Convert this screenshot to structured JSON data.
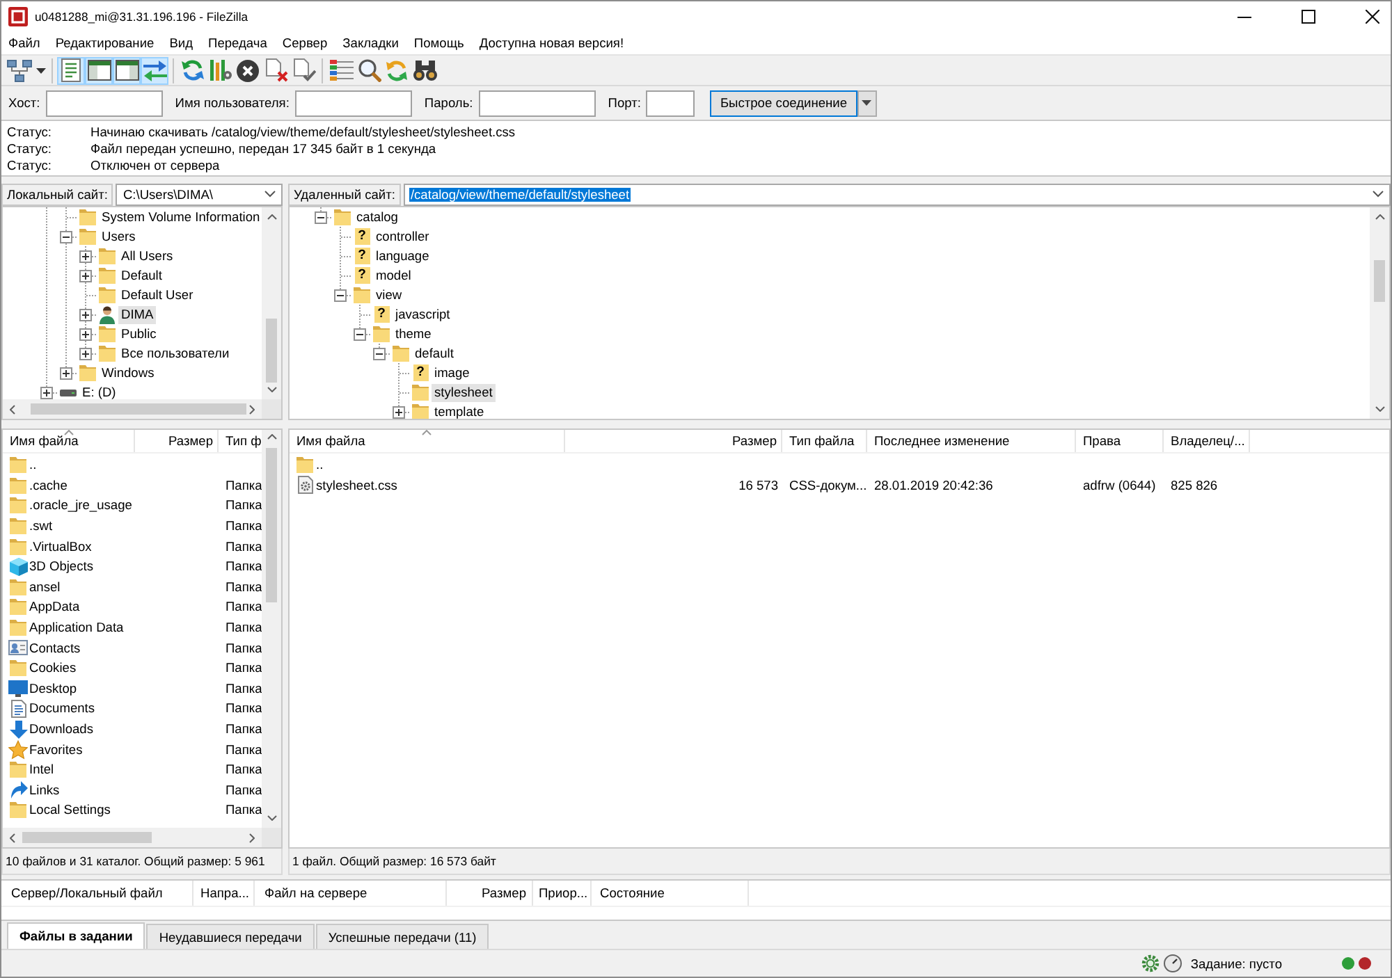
{
  "window": {
    "title": "u0481288_mi@31.31.196.196 - FileZilla"
  },
  "menu": [
    "Файл",
    "Редактирование",
    "Вид",
    "Передача",
    "Сервер",
    "Закладки",
    "Помощь",
    "Доступна новая версия!"
  ],
  "toolbar": [
    [
      {
        "kind": "sitemanager",
        "pressed": false,
        "dropdown": true
      }
    ],
    [
      {
        "kind": "messagelog",
        "pressed": true,
        "dropdown": false
      },
      {
        "kind": "localtree",
        "pressed": true,
        "dropdown": false
      },
      {
        "kind": "remotetree",
        "pressed": true,
        "dropdown": false
      },
      {
        "kind": "queue",
        "pressed": true,
        "dropdown": false
      }
    ],
    [
      {
        "kind": "refresh",
        "pressed": false,
        "dropdown": false
      },
      {
        "kind": "processqueue",
        "pressed": false,
        "dropdown": false
      },
      {
        "kind": "cancel",
        "pressed": false,
        "dropdown": false
      },
      {
        "kind": "disconnect",
        "pressed": false,
        "dropdown": false
      },
      {
        "kind": "reconnect",
        "pressed": false,
        "dropdown": false
      }
    ],
    [
      {
        "kind": "filter",
        "pressed": false,
        "dropdown": false
      },
      {
        "kind": "syncbrowse",
        "pressed": false,
        "dropdown": false
      },
      {
        "kind": "compare",
        "pressed": false,
        "dropdown": false
      },
      {
        "kind": "search",
        "pressed": false,
        "dropdown": false
      }
    ]
  ],
  "quickconnect": {
    "fields": [
      {
        "label": "Хост:",
        "kind": "wide"
      },
      {
        "label": "Имя пользователя:",
        "kind": "wide"
      },
      {
        "label": "Пароль:",
        "kind": "wide"
      },
      {
        "label": "Порт:",
        "kind": "narrow"
      }
    ],
    "button": "Быстрое соединение"
  },
  "message_log": [
    {
      "label": "Статус:",
      "message": "Начинаю скачивать /catalog/view/theme/default/stylesheet/stylesheet.css"
    },
    {
      "label": "Статус:",
      "message": "Файл передан успешно, передан 17 345 байт в 1 секунда"
    },
    {
      "label": "Статус:",
      "message": "Отключен от сервера"
    }
  ],
  "local": {
    "site_label": "Локальный сайт:",
    "path": "C:\\Users\\DIMA\\",
    "path_selected": false,
    "tree": [
      {
        "children": [
          {
            "label": "System Volume Information",
            "kind": "folder",
            "expandable": false,
            "selected": false
          },
          {
            "label": "Users",
            "kind": "folder",
            "expandable": true,
            "expanded": true,
            "selected": false,
            "children": [
              {
                "label": "All Users",
                "kind": "folder",
                "expandable": true,
                "expanded": false,
                "selected": false
              },
              {
                "label": "Default",
                "kind": "folder",
                "expandable": true,
                "expanded": false,
                "selected": false
              },
              {
                "label": "Default User",
                "kind": "folder",
                "expandable": false,
                "selected": false
              },
              {
                "label": "DIMA",
                "kind": "user",
                "expandable": true,
                "expanded": false,
                "selected": true
              },
              {
                "label": "Public",
                "kind": "folder",
                "expandable": true,
                "expanded": false,
                "selected": false
              },
              {
                "label": "Все пользователи",
                "kind": "folder",
                "expandable": true,
                "expanded": false,
                "selected": false
              }
            ]
          },
          {
            "label": "Windows",
            "kind": "folder",
            "expandable": true,
            "expanded": false,
            "selected": false
          }
        ]
      },
      {
        "label": "E: (D)",
        "kind": "drive",
        "expandable": true,
        "expanded": false,
        "selected": false
      }
    ],
    "columns": [
      {
        "label": "Имя файла",
        "sorted": true
      },
      {
        "label": "Размер",
        "sorted": false
      },
      {
        "label": "Тип ф",
        "sorted": false
      }
    ],
    "rows": [
      {
        "name": "..",
        "kind": "folder"
      },
      {
        "name": ".cache",
        "kind": "folder",
        "type": "Папка"
      },
      {
        "name": ".oracle_jre_usage",
        "kind": "folder",
        "type": "Папка"
      },
      {
        "name": ".swt",
        "kind": "folder",
        "type": "Папка"
      },
      {
        "name": ".VirtualBox",
        "kind": "folder",
        "type": "Папка"
      },
      {
        "name": "3D Objects",
        "kind": "cube",
        "type": "Папка"
      },
      {
        "name": "ansel",
        "kind": "folder",
        "type": "Папка"
      },
      {
        "name": "AppData",
        "kind": "folder",
        "type": "Папка"
      },
      {
        "name": "Application Data",
        "kind": "folder",
        "type": "Папка"
      },
      {
        "name": "Contacts",
        "kind": "contacts",
        "type": "Папка"
      },
      {
        "name": "Cookies",
        "kind": "folder",
        "type": "Папка"
      },
      {
        "name": "Desktop",
        "kind": "desktop",
        "type": "Папка"
      },
      {
        "name": "Documents",
        "kind": "documents",
        "type": "Папка"
      },
      {
        "name": "Downloads",
        "kind": "downloads",
        "type": "Папка"
      },
      {
        "name": "Favorites",
        "kind": "favorites",
        "type": "Папка"
      },
      {
        "name": "Intel",
        "kind": "folder",
        "type": "Папка"
      },
      {
        "name": "Links",
        "kind": "links",
        "type": "Папка"
      },
      {
        "name": "Local Settings",
        "kind": "folder",
        "type": "Папка"
      }
    ],
    "status": "10 файлов и 31 каталог. Общий размер: 5 961"
  },
  "remote": {
    "site_label": "Удаленный сайт:",
    "path": "/catalog/view/theme/default/stylesheet",
    "path_selected": true,
    "tree": [
      {
        "children": [
          {
            "label": "catalog",
            "kind": "folder",
            "expandable": true,
            "expanded": true,
            "selected": false,
            "children": [
              {
                "label": "controller",
                "kind": "unknown",
                "glyph": "?",
                "expandable": false,
                "selected": false
              },
              {
                "label": "language",
                "kind": "unknown",
                "glyph": "?",
                "expandable": false,
                "selected": false
              },
              {
                "label": "model",
                "kind": "unknown",
                "glyph": "?",
                "expandable": false,
                "selected": false
              },
              {
                "label": "view",
                "kind": "folder",
                "expandable": true,
                "expanded": true,
                "selected": false,
                "children": [
                  {
                    "label": "javascript",
                    "kind": "unknown",
                    "glyph": "?",
                    "expandable": false,
                    "selected": false
                  },
                  {
                    "label": "theme",
                    "kind": "folder",
                    "expandable": true,
                    "expanded": true,
                    "selected": false,
                    "children": [
                      {
                        "label": "default",
                        "kind": "folder",
                        "expandable": true,
                        "expanded": true,
                        "selected": false,
                        "children": [
                          {
                            "label": "image",
                            "kind": "unknown",
                            "glyph": "?",
                            "expandable": false,
                            "selected": false
                          },
                          {
                            "label": "stylesheet",
                            "kind": "folder",
                            "expandable": false,
                            "selected": true
                          },
                          {
                            "label": "template",
                            "kind": "folder",
                            "expandable": true,
                            "expanded": false,
                            "selected": false
                          }
                        ]
                      }
                    ]
                  }
                ]
              }
            ]
          }
        ]
      }
    ],
    "columns": [
      {
        "label": "Имя файла",
        "sorted": true
      },
      {
        "label": "Размер",
        "sorted": false
      },
      {
        "label": "Тип файла",
        "sorted": false
      },
      {
        "label": "Последнее изменение",
        "sorted": false
      },
      {
        "label": "Права",
        "sorted": false
      },
      {
        "label": "Владелец/...",
        "sorted": false
      }
    ],
    "rows": [
      {
        "name": "..",
        "kind": "folder"
      },
      {
        "name": "stylesheet.css",
        "kind": "file",
        "size": "16 573",
        "type": "CSS-докум...",
        "modified": "28.01.2019 20:42:36",
        "permissions": "adfrw (0644)",
        "owner": "825 826"
      }
    ],
    "status": "1 файл. Общий размер: 16 573 байт"
  },
  "queue": {
    "columns": [
      "Сервер/Локальный файл",
      "Напра...",
      "Файл на сервере",
      "Размер",
      "Приор...",
      "Состояние"
    ]
  },
  "queue_tabs": [
    {
      "label": "Файлы в задании",
      "selected": true
    },
    {
      "label": "Неудавшиеся передачи",
      "selected": false
    },
    {
      "label": "Успешные передачи (11)",
      "selected": false
    }
  ],
  "status_bar": {
    "queue": "Задание: пусто",
    "indicators": [
      {
        "color": "#2e9e3a"
      },
      {
        "color": "#b3262a"
      }
    ]
  }
}
